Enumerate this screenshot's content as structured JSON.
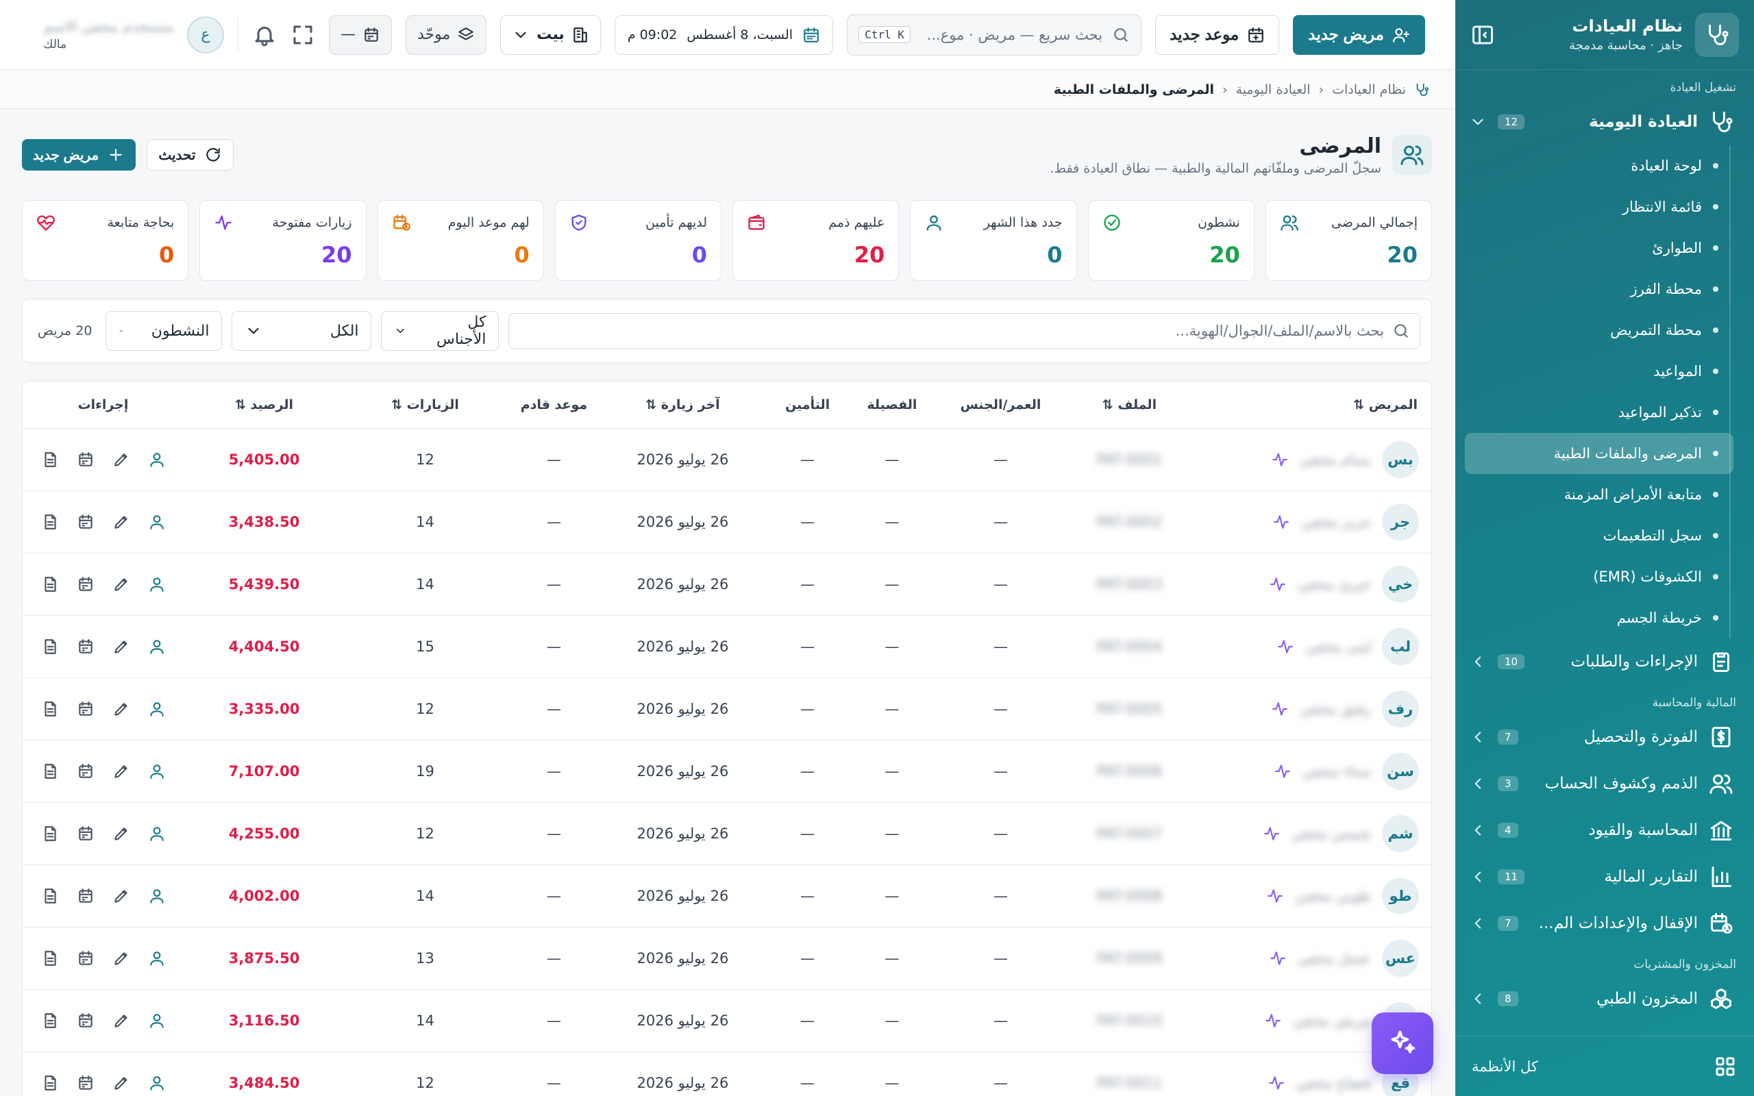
{
  "sidebar": {
    "app_title": "نظام العيادات",
    "app_subtitle": "جاهز · محاسبة مدمجة",
    "sections": {
      "clinic_ops": "تشغيل العيادة",
      "finance": "المالية والمحاسبة",
      "inventory": "المخزون والمشتريات"
    },
    "daily_clinic": {
      "label": "العيادة اليومية",
      "badge": "12"
    },
    "sub_items": [
      "لوحة العيادة",
      "قائمة الانتظار",
      "الطوارئ",
      "محطة الفرز",
      "محطة التمريض",
      "المواعيد",
      "تذكير المواعيد",
      "المرضى والملفات الطبية",
      "متابعة الأمراض المزمنة",
      "سجل التطعيمات",
      "الكشوفات (EMR)",
      "خريطة الجسم"
    ],
    "procedures": {
      "label": "الإجراءات والطلبات",
      "badge": "10"
    },
    "finance_groups": [
      {
        "label": "الفوترة والتحصيل",
        "badge": "7"
      },
      {
        "label": "الذمم وكشوف الحساب",
        "badge": "3"
      },
      {
        "label": "المحاسبة والقيود",
        "badge": "4"
      },
      {
        "label": "التقارير المالية",
        "badge": "11"
      },
      {
        "label": "الإقفال والإعدادات الم...",
        "badge": "7"
      }
    ],
    "inventory_group": {
      "label": "المخزون الطبي",
      "badge": "8"
    },
    "footer_label": "كل الأنظمة"
  },
  "topbar": {
    "new_patient": "مريض جديد",
    "new_appointment": "موعد جديد",
    "search_placeholder": "بحث سريع — مريض · موع...",
    "search_shortcut": "Ctrl K",
    "date": "السبت، 8 أغسطس",
    "time": "09:02 م",
    "branch": "بيت",
    "unified": "موحّد",
    "dash": "—",
    "avatar_initial": "ع",
    "user_name": "مستخدم مخفي الاسم",
    "user_role": "مالك"
  },
  "breadcrumb": {
    "root": "نظام العيادات",
    "parent": "العيادة اليومية",
    "current": "المرضى والملفات الطبية"
  },
  "page": {
    "title": "المرضى",
    "description": "سجلّ المرضى وملفّاتهم المالية والطبية — نطاق العيادة فقط.",
    "refresh": "تحديث",
    "new_patient": "مريض جديد"
  },
  "stats": [
    {
      "label": "إجمالي المرضى",
      "value": "20",
      "color": "#1b7a8c",
      "icon": "users-icon"
    },
    {
      "label": "نشطون",
      "value": "20",
      "color": "#16a34a",
      "icon": "check-circle-icon"
    },
    {
      "label": "جدد هذا الشهر",
      "value": "0",
      "color": "#1b7a8c",
      "icon": "user-icon"
    },
    {
      "label": "عليهم ذمم",
      "value": "20",
      "color": "#e11d48",
      "icon": "wallet-icon"
    },
    {
      "label": "لديهم تأمين",
      "value": "0",
      "color": "#6d4aed",
      "icon": "shield-icon"
    },
    {
      "label": "لهم موعد اليوم",
      "value": "0",
      "color": "#ea7a12",
      "icon": "calendar-clock-icon"
    },
    {
      "label": "زيارات مفتوحة",
      "value": "20",
      "color": "#7c3aed",
      "icon": "activity-icon"
    },
    {
      "label": "بحاجة متابعة",
      "value": "0",
      "color": "#ea580c",
      "icon": "heart-pulse-icon"
    }
  ],
  "filters": {
    "search_placeholder": "بحث بالاسم/الملف/الجوال/الهوية...",
    "gender": "كل الأجناس",
    "type": "الكل",
    "status": "النشطون",
    "count": "20 مريض"
  },
  "table": {
    "headers": {
      "patient": "المريض",
      "file": "الملف",
      "age_gender": "العمر/الجنس",
      "blood": "الفصيلة",
      "insurance": "التأمين",
      "last_visit": "آخر زيارة",
      "next_appt": "موعد قادم",
      "visits": "الزيارات",
      "balance": "الرصيد",
      "actions": "إجراءات"
    },
    "rows": [
      {
        "initials": "بس",
        "name": "بسام مخفي",
        "file": "PAT-0001",
        "age": "—",
        "blood": "—",
        "insurance": "—",
        "last_visit": "26 يوليو 2026",
        "next": "—",
        "visits": "12",
        "balance": "5,405.00"
      },
      {
        "initials": "جر",
        "name": "جرير مخفي",
        "file": "PAT-0002",
        "age": "—",
        "blood": "—",
        "insurance": "—",
        "last_visit": "26 يوليو 2026",
        "next": "—",
        "visits": "14",
        "balance": "3,438.50"
      },
      {
        "initials": "خي",
        "name": "خيري مخفي",
        "file": "PAT-0003",
        "age": "—",
        "blood": "—",
        "insurance": "—",
        "last_visit": "26 يوليو 2026",
        "next": "—",
        "visits": "14",
        "balance": "5,439.50"
      },
      {
        "initials": "لب",
        "name": "لبنى مخفي",
        "file": "PAT-0004",
        "age": "—",
        "blood": "—",
        "insurance": "—",
        "last_visit": "26 يوليو 2026",
        "next": "—",
        "visits": "15",
        "balance": "4,404.50"
      },
      {
        "initials": "رف",
        "name": "رفيق مخفي",
        "file": "PAT-0005",
        "age": "—",
        "blood": "—",
        "insurance": "—",
        "last_visit": "26 يوليو 2026",
        "next": "—",
        "visits": "12",
        "balance": "3,335.00"
      },
      {
        "initials": "سن",
        "name": "سناء مخفي",
        "file": "PAT-0006",
        "age": "—",
        "blood": "—",
        "insurance": "—",
        "last_visit": "26 يوليو 2026",
        "next": "—",
        "visits": "19",
        "balance": "7,107.00"
      },
      {
        "initials": "شم",
        "name": "شمس مخفي",
        "file": "PAT-0007",
        "age": "—",
        "blood": "—",
        "insurance": "—",
        "last_visit": "26 يوليو 2026",
        "next": "—",
        "visits": "12",
        "balance": "4,255.00"
      },
      {
        "initials": "طو",
        "name": "طوني مخفي",
        "file": "PAT-0008",
        "age": "—",
        "blood": "—",
        "insurance": "—",
        "last_visit": "26 يوليو 2026",
        "next": "—",
        "visits": "14",
        "balance": "4,002.00"
      },
      {
        "initials": "عس",
        "name": "عسل مخفي",
        "file": "PAT-0009",
        "age": "—",
        "blood": "—",
        "insurance": "—",
        "last_visit": "26 يوليو 2026",
        "next": "—",
        "visits": "13",
        "balance": "3,875.50"
      },
      {
        "initials": "",
        "name": "مريض مخفي",
        "file": "PAT-0010",
        "age": "—",
        "blood": "—",
        "insurance": "—",
        "last_visit": "26 يوليو 2026",
        "next": "—",
        "visits": "14",
        "balance": "3,116.50"
      },
      {
        "initials": "قع",
        "name": "قعقاع مخفي",
        "file": "PAT-0011",
        "age": "—",
        "blood": "—",
        "insurance": "—",
        "last_visit": "26 يوليو 2026",
        "next": "—",
        "visits": "12",
        "balance": "3,484.50"
      }
    ]
  },
  "colors": {
    "brand": "#1b7a8c",
    "balance": "#e11d48",
    "fab": "#7c5cf0"
  }
}
